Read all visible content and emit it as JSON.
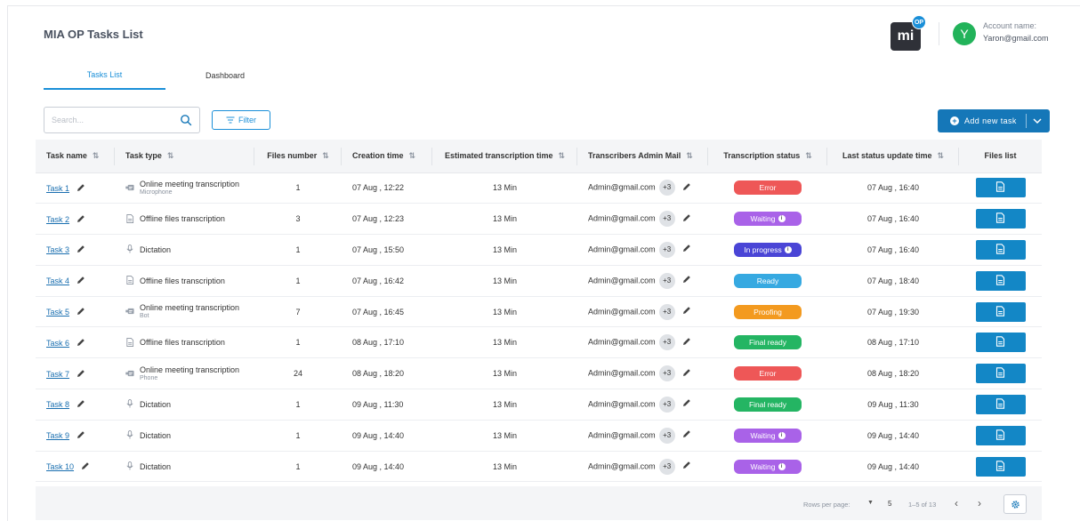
{
  "app": {
    "title": "MIA OP Tasks List"
  },
  "brand": {
    "logo_text": "mi",
    "badge_text": "OP"
  },
  "account": {
    "label": "Account name:",
    "email": "Yaron@gmail.com",
    "initial": "Y",
    "avatar_color": "#22b35a"
  },
  "tabs": [
    {
      "label": "Tasks List",
      "active": true
    },
    {
      "label": "Dashboard",
      "active": false
    }
  ],
  "toolbar": {
    "search_placeholder": "Search...",
    "filter_label": "Filter",
    "add_label": "Add new task"
  },
  "table": {
    "columns": [
      {
        "label": "Task name",
        "sortable": true
      },
      {
        "label": "Task type",
        "sortable": true
      },
      {
        "label": "Files number",
        "sortable": true
      },
      {
        "label": "Creation time",
        "sortable": true
      },
      {
        "label": "Estimated transcription time",
        "sortable": true
      },
      {
        "label": "Transcribers Admin Mail",
        "sortable": true
      },
      {
        "label": "Transcription status",
        "sortable": true
      },
      {
        "label": "Last status update time",
        "sortable": true
      },
      {
        "label": "Files list",
        "sortable": false
      }
    ],
    "rows": [
      {
        "name": "Task 1",
        "type": "Online meeting transcription",
        "sub": "Microphone",
        "icon": "meeting-icon",
        "files": "1",
        "created": "07 Aug , 12:22",
        "est": "13 Min",
        "mail": "Admin@gmail.com",
        "extra": "+3",
        "status": "Error",
        "status_key": "error",
        "info": false,
        "updated": "07 Aug , 16:40"
      },
      {
        "name": "Task 2",
        "type": "Offline files transcription",
        "sub": "",
        "icon": "file-icon",
        "files": "3",
        "created": "07 Aug , 12:23",
        "est": "13 Min",
        "mail": "Admin@gmail.com",
        "extra": "+3",
        "status": "Waiting",
        "status_key": "waiting",
        "info": true,
        "updated": "07 Aug , 16:40"
      },
      {
        "name": "Task 3",
        "type": "Dictation",
        "sub": "",
        "icon": "microphone-icon",
        "files": "1",
        "created": "07 Aug , 15:50",
        "est": "13 Min",
        "mail": "Admin@gmail.com",
        "extra": "+3",
        "status": "In progress",
        "status_key": "progress",
        "info": true,
        "updated": "07 Aug , 16:40"
      },
      {
        "name": "Task 4",
        "type": "Offline files transcription",
        "sub": "",
        "icon": "file-icon",
        "files": "1",
        "created": "07 Aug , 16:42",
        "est": "13 Min",
        "mail": "Admin@gmail.com",
        "extra": "+3",
        "status": "Ready",
        "status_key": "ready",
        "info": false,
        "updated": "07 Aug , 18:40"
      },
      {
        "name": "Task 5",
        "type": "Online meeting transcription",
        "sub": "Bot",
        "icon": "meeting-icon",
        "files": "7",
        "created": "07 Aug , 16:45",
        "est": "13 Min",
        "mail": "Admin@gmail.com",
        "extra": "+3",
        "status": "Proofing",
        "status_key": "proofing",
        "info": false,
        "updated": "07 Aug , 19:30"
      },
      {
        "name": "Task 6",
        "type": "Offline files transcription",
        "sub": "",
        "icon": "file-icon",
        "files": "1",
        "created": "08 Aug , 17:10",
        "est": "13 Min",
        "mail": "Admin@gmail.com",
        "extra": "+3",
        "status": "Final ready",
        "status_key": "final",
        "info": false,
        "updated": "08 Aug , 17:10"
      },
      {
        "name": "Task 7",
        "type": "Online meeting transcription",
        "sub": "Phone",
        "icon": "meeting-icon",
        "files": "24",
        "created": "08 Aug , 18:20",
        "est": "13 Min",
        "mail": "Admin@gmail.com",
        "extra": "+3",
        "status": "Error",
        "status_key": "error",
        "info": false,
        "updated": "08 Aug , 18:20"
      },
      {
        "name": "Task 8",
        "type": "Dictation",
        "sub": "",
        "icon": "microphone-icon",
        "files": "1",
        "created": "09 Aug , 11:30",
        "est": "13 Min",
        "mail": "Admin@gmail.com",
        "extra": "+3",
        "status": "Final ready",
        "status_key": "final",
        "info": false,
        "updated": "09 Aug , 11:30"
      },
      {
        "name": "Task 9",
        "type": "Dictation",
        "sub": "",
        "icon": "microphone-icon",
        "files": "1",
        "created": "09 Aug , 14:40",
        "est": "13 Min",
        "mail": "Admin@gmail.com",
        "extra": "+3",
        "status": "Waiting",
        "status_key": "waiting",
        "info": true,
        "updated": "09 Aug , 14:40"
      },
      {
        "name": "Task 10",
        "type": "Dictation",
        "sub": "",
        "icon": "microphone-icon",
        "files": "1",
        "created": "09 Aug , 14:40",
        "est": "13 Min",
        "mail": "Admin@gmail.com",
        "extra": "+3",
        "status": "Waiting",
        "status_key": "waiting",
        "info": true,
        "updated": "09 Aug , 14:40"
      }
    ]
  },
  "status_colors": {
    "error": "#ee5757",
    "waiting": "#a962e8",
    "progress": "#4a45d6",
    "ready": "#36a9e1",
    "proofing": "#f39a1f",
    "final": "#24b563"
  },
  "pagination": {
    "rows_per_page_label": "Rows per page:",
    "rows_per_page": "5",
    "range": "1–5 of 13"
  },
  "colors": {
    "accent": "#1a8fd8",
    "primary_button": "#1577b8",
    "file_button": "#1387c6"
  }
}
